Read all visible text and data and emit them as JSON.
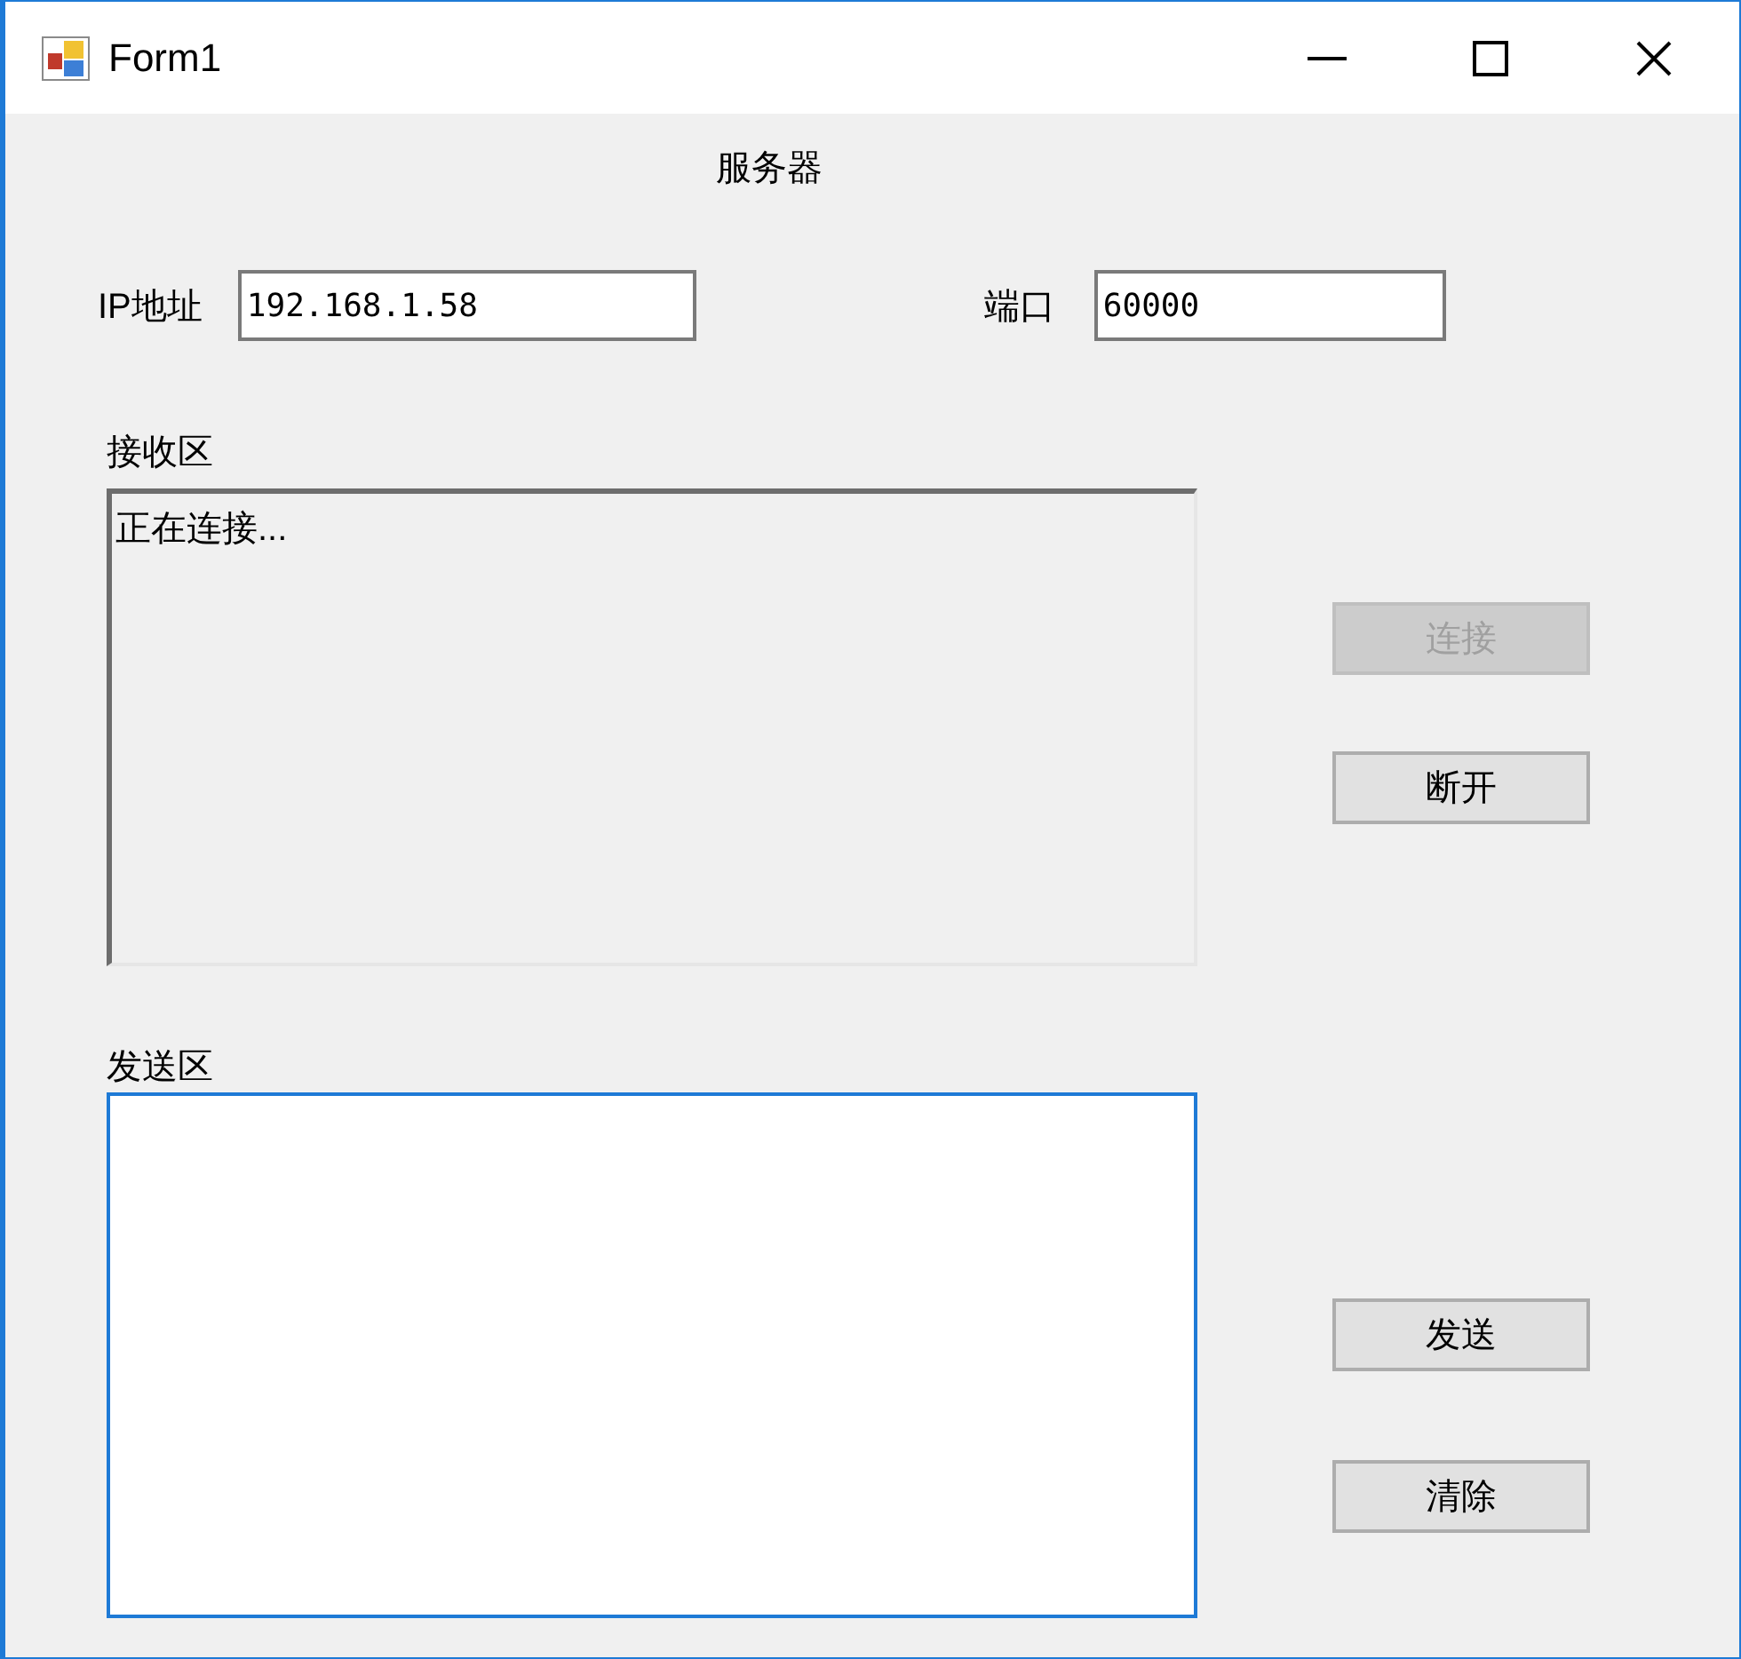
{
  "window": {
    "title": "Form1"
  },
  "heading": "服务器",
  "fields": [
    {
      "label": "IP地址",
      "value": "192.168.1.58"
    },
    {
      "label": "端口",
      "value": "60000"
    }
  ],
  "receive": {
    "label": "接收区",
    "text": "正在连接...",
    "readonly": true
  },
  "send": {
    "label": "发送区",
    "focused": true
  },
  "connection_buttons": [
    {
      "label": "连接",
      "disabled": true
    },
    {
      "label": "断开",
      "disabled": false
    }
  ],
  "send_buttons": [
    {
      "label": "发送",
      "disabled": false
    },
    {
      "label": "清除",
      "disabled": false
    }
  ]
}
